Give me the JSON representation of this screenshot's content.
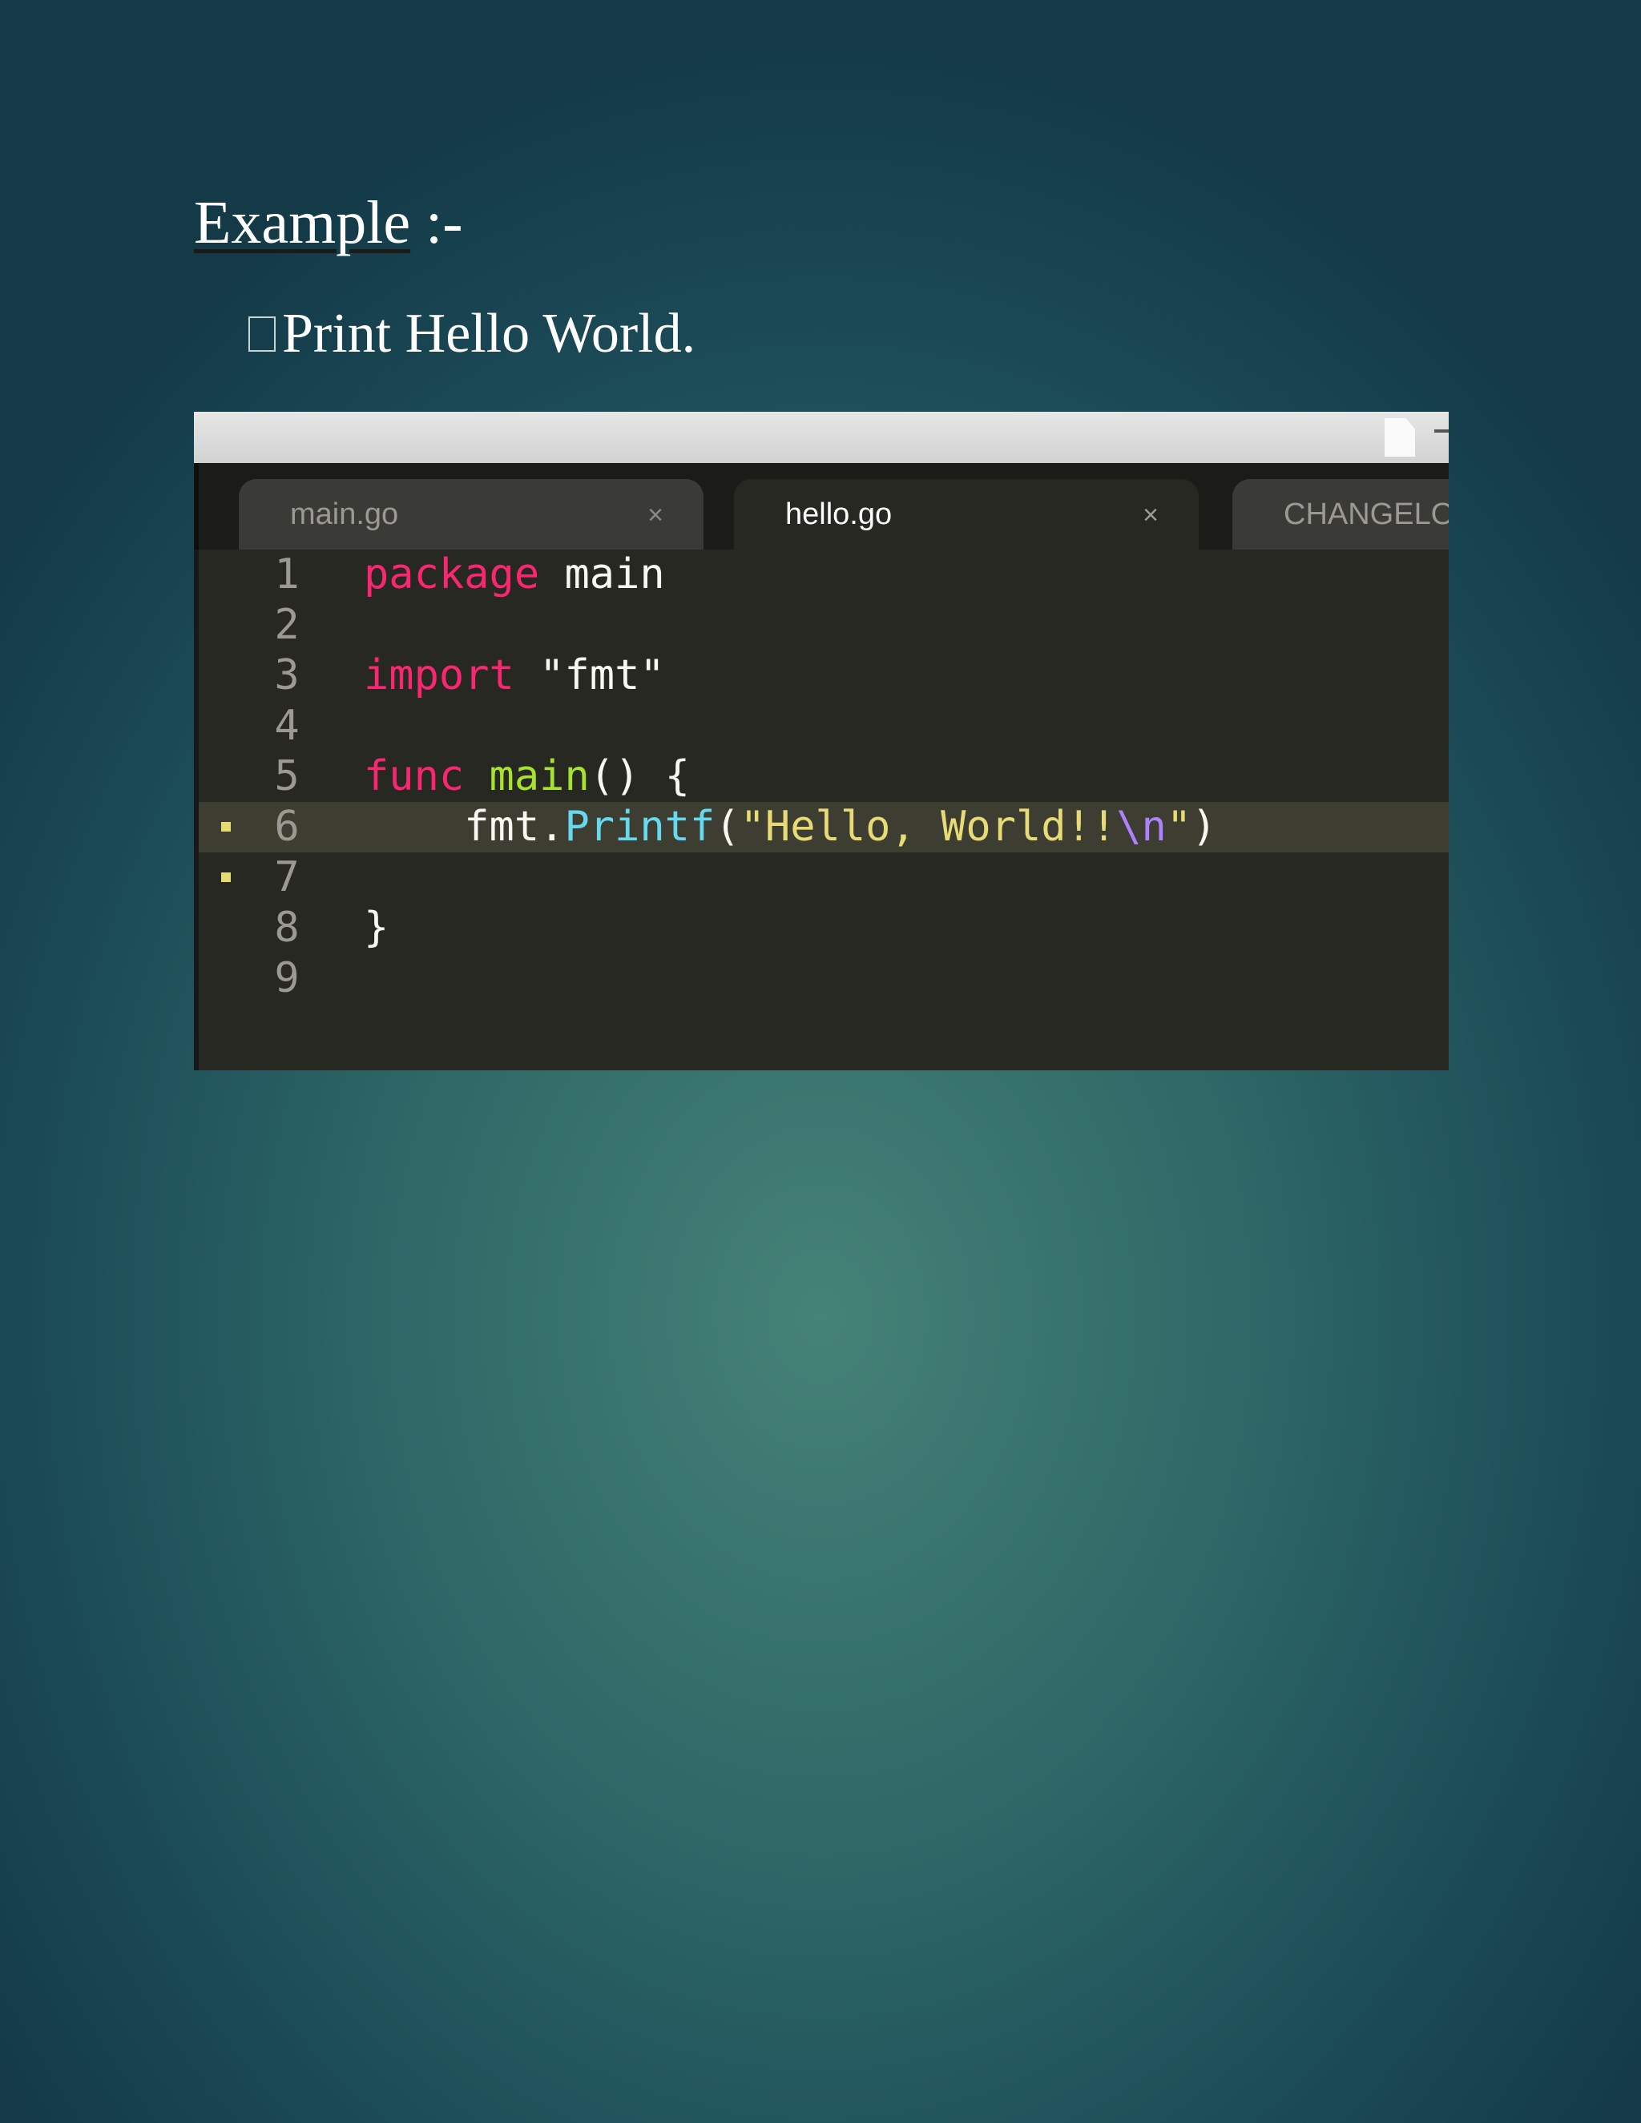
{
  "heading": {
    "word": "Example",
    "suffix": " :-"
  },
  "bullet": {
    "text": "Print Hello World."
  },
  "editor": {
    "tabs": [
      {
        "label": "main.go",
        "close": "×"
      },
      {
        "label": "hello.go",
        "close": "×",
        "active": true
      },
      {
        "label": "CHANGELO"
      }
    ],
    "lines": [
      {
        "no": "1"
      },
      {
        "no": "2"
      },
      {
        "no": "3"
      },
      {
        "no": "4"
      },
      {
        "no": "5"
      },
      {
        "no": "6",
        "modified": true,
        "current": true
      },
      {
        "no": "7",
        "modified": true
      },
      {
        "no": "8"
      },
      {
        "no": "9"
      }
    ],
    "tokens": {
      "l1_kw": "package",
      "l1_name": " main",
      "l3_kw": "import",
      "l3_str": " \"fmt\"",
      "l5_kw": "func",
      "l5_fn": " main",
      "l5_rest": "() {",
      "l6_obj": "    fmt.",
      "l6_call": "Printf",
      "l6_open": "(",
      "l6_str": "\"Hello, World!!",
      "l6_esc": "\\n",
      "l6_close_str": "\"",
      "l6_close": ")",
      "l8_brace": "}"
    },
    "colors": {
      "keyword": "#f92672",
      "function": "#a6e22e",
      "string": "#e6db74",
      "builtin": "#66d9ef",
      "escape": "#ae81ff",
      "background": "#272822"
    }
  }
}
